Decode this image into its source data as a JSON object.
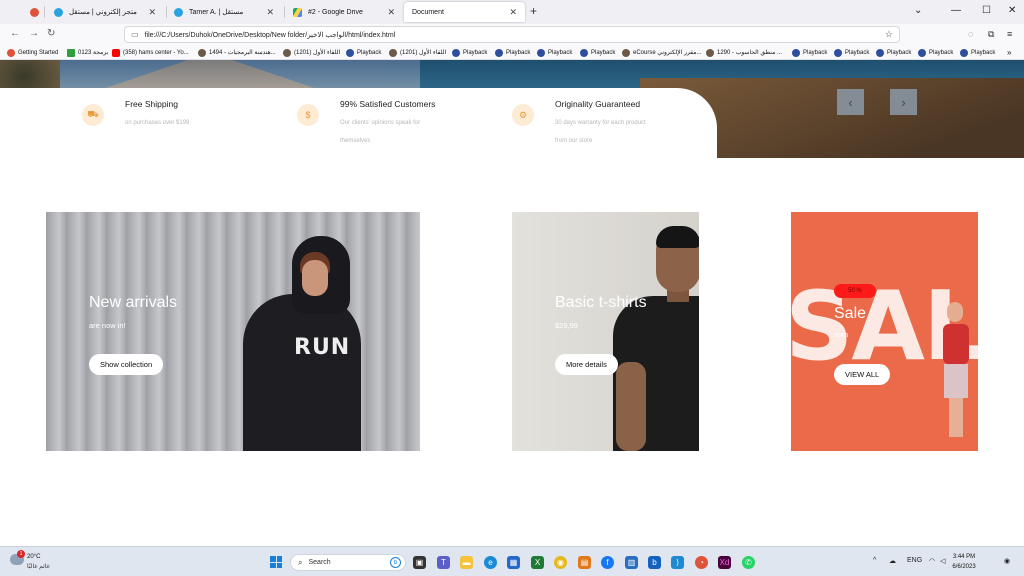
{
  "browser": {
    "tabs": [
      {
        "title": "",
        "icon": "firefox-view-icon",
        "active": false
      },
      {
        "title": "متجر إلكتروني | مستقل",
        "icon": "mostaql-icon",
        "active": false
      },
      {
        "title": "Tamer A. | مستقل",
        "icon": "mostaql-icon",
        "active": false
      },
      {
        "title": "#2 - Google Drive",
        "icon": "google-drive-icon",
        "active": false
      },
      {
        "title": "Document",
        "icon": "",
        "active": true
      }
    ],
    "url": "file:///C:/Users/Duhok/OneDrive/Desktop/New folder/الواجب الاخير/html/index.html",
    "bookmarks": [
      "Getting Started",
      "برمجة 0123",
      "(358) hams center - Yo...",
      "هندسة البرمجيات - 1494...",
      "(1201) اللقاء الأول",
      "Playback",
      "(1201) اللقاء الأول",
      "Playback",
      "Playback",
      "Playback",
      "Playback",
      "eCourse مقرر الإلكتروني...",
      "1290 - منطق الحاسوب ...",
      "Playback",
      "Playback",
      "Playback",
      "Playback",
      "Playback"
    ]
  },
  "page": {
    "features": [
      {
        "icon": "truck-icon",
        "title": "Free Shipping",
        "desc": "on purchases over $199"
      },
      {
        "icon": "dollar-icon",
        "title": "99% Satisfied Customers",
        "desc": "Our clients' opinions speak for themselves"
      },
      {
        "icon": "gear-icon",
        "title": "Originality Guaranteed",
        "desc": "30 days warranty for each product from our store"
      }
    ],
    "cards": {
      "new_arrivals": {
        "title": "New arrivals",
        "subtitle": "are now in!",
        "button": "Show collection"
      },
      "basic_tshirts": {
        "title": "Basic t-shirts",
        "subtitle": "$29,99",
        "button": "More details"
      },
      "sale": {
        "badge": "50 %",
        "title": "Sale",
        "subtitle": "sum",
        "button": "VIEW ALL",
        "bg_text": "SAL"
      }
    }
  },
  "taskbar": {
    "weather_temp": "20°C",
    "weather_cond": "غائم غالبًا",
    "notification_count": "1",
    "search_placeholder": "Search",
    "language": "ENG",
    "time": "3:44 PM",
    "date": "6/6/2023",
    "colors": {
      "accent": "#1a7fd8"
    }
  }
}
